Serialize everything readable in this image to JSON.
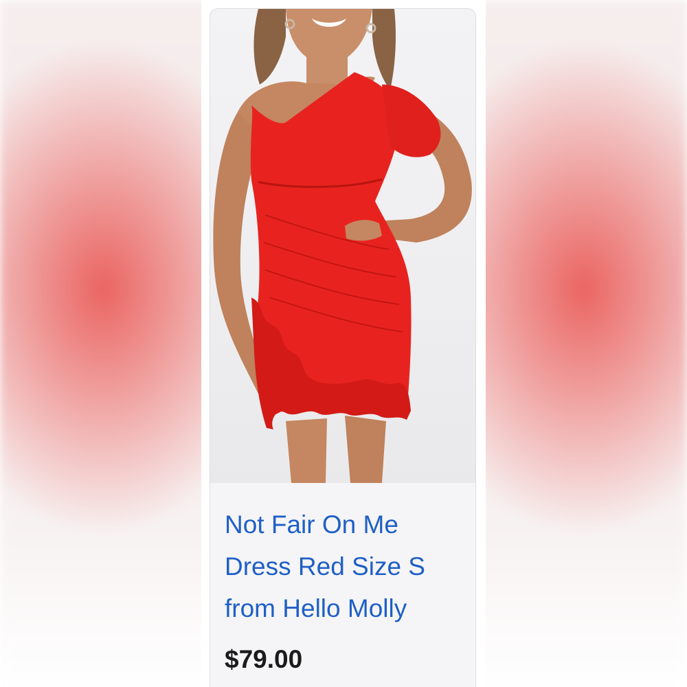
{
  "product": {
    "title": "Not Fair On Me Dress Red Size S from Hello Molly",
    "price": "$79.00",
    "image_subject": "model wearing red one-shoulder ruffle mini dress"
  },
  "colors": {
    "title_link": "#1f5fc6",
    "price_text": "#1b1b1b",
    "dress": "#e8231f",
    "backdrop_red": "#e8403c"
  }
}
